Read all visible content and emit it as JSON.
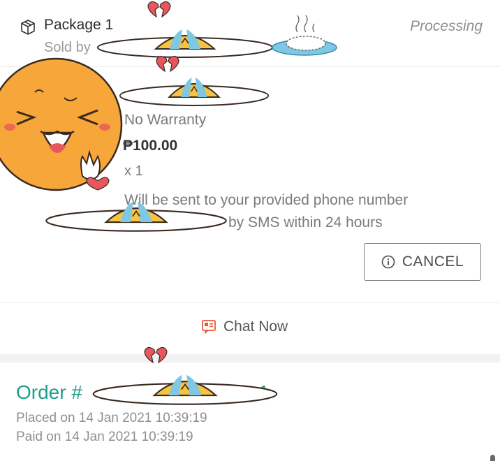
{
  "package": {
    "title": "Package 1",
    "sold_by_label": "Sold by",
    "status": "Processing"
  },
  "item": {
    "variant": "No Warranty",
    "price": "₱100.00",
    "quantity": "x 1",
    "delivery_line_1": "Will be sent to your provided phone number",
    "delivery_line_2": "by SMS within 24 hours"
  },
  "actions": {
    "cancel_label": "CANCEL",
    "chat_label": "Chat Now"
  },
  "order": {
    "number_prefix": "Order #",
    "number_suffix": "1",
    "placed": "Placed on 14 Jan 2021  10:39:19",
    "paid": "Paid on 14 Jan 2021  10:39:19"
  },
  "colors": {
    "accent_teal": "#1e9e8a",
    "chat_icon": "#e8573a",
    "sticker_yolk": "#f6c343",
    "sticker_face": "#f7a73a"
  }
}
